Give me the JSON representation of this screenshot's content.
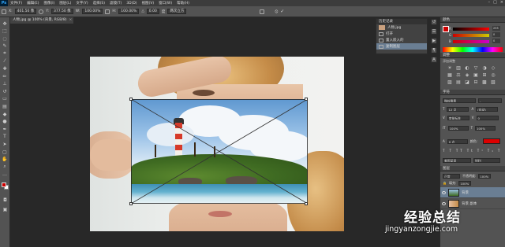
{
  "app": {
    "logo": "Ps"
  },
  "menu": [
    "文件(F)",
    "编辑(E)",
    "图像(I)",
    "图层(L)",
    "文字(Y)",
    "选择(S)",
    "滤镜(T)",
    "3D(D)",
    "视图(V)",
    "窗口(W)",
    "帮助(H)"
  ],
  "window_controls": [
    "–",
    "□",
    "×"
  ],
  "options_bar": {
    "x_label": "X:",
    "x_value": "401.50 像",
    "y_label": "Y:",
    "y_value": "377.50 像",
    "w_label": "W:",
    "w_value": "100.00%",
    "h_label": "H:",
    "h_value": "100.00%",
    "angle_label": "△",
    "angle_value": "0.00",
    "interp_label": "度",
    "interp_value": "两次立方",
    "cancel_icon": "cancel-transform-icon",
    "commit_icon": "commit-transform-icon"
  },
  "document": {
    "tab_title": "人物.jpg @ 100% (背景, RGB/8)",
    "close": "×"
  },
  "history": {
    "title": "历史记录",
    "snapshot": "人物.jpg",
    "items": [
      "打开",
      "置入嵌入的",
      "复制图层"
    ]
  },
  "color_panel": {
    "title": "颜色",
    "sliders": [
      {
        "label": "R",
        "value": "255"
      },
      {
        "label": "G",
        "value": "0"
      },
      {
        "label": "B",
        "value": "0"
      }
    ],
    "accent": "#cc0000"
  },
  "adjustments_panel": {
    "title": "调整",
    "subtitle": "添加调整",
    "icons": [
      "☀",
      "▥",
      "◐",
      "▽",
      "◑",
      "◇",
      "▦",
      "⚖",
      "◈",
      "▣",
      "⊞",
      "◎",
      "▨",
      "▤",
      "◪",
      "⊟",
      "▩",
      "▧"
    ]
  },
  "character_panel": {
    "title": "字符",
    "font": "微软雅黑",
    "style": "-",
    "size": "12 点",
    "leading": "(自动)",
    "tracking": "0",
    "kerning": "度量标准",
    "scale_v": "100%",
    "scale_h": "100%",
    "baseline": "0 点",
    "color_label": "颜色:",
    "lang": "美国英语",
    "aa": "锐利"
  },
  "layers_panel": {
    "title": "图层",
    "blend": "正常",
    "opacity_label": "不透明度:",
    "opacity": "100%",
    "fill_label": "填充:",
    "fill": "100%",
    "layers": [
      {
        "name": "背景",
        "active": true
      },
      {
        "name": "背景 副本",
        "active": false
      }
    ]
  },
  "watermark": {
    "text": "经验总结",
    "url": "jingyanzongjie.com"
  }
}
